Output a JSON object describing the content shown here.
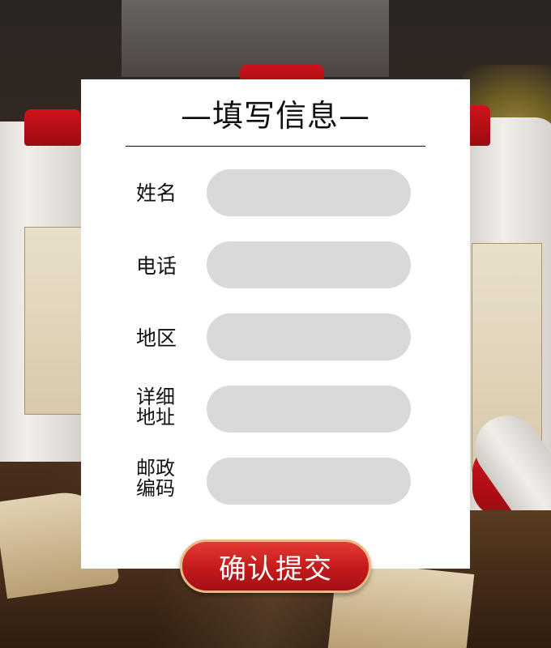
{
  "form": {
    "title": "—填写信息—",
    "fields": [
      {
        "label": "姓名",
        "value": ""
      },
      {
        "label": "电话",
        "value": ""
      },
      {
        "label": "地区",
        "value": ""
      },
      {
        "label_line1": "详细",
        "label_line2": "地址",
        "value": ""
      },
      {
        "label_line1": "邮政",
        "label_line2": "编码",
        "value": ""
      }
    ],
    "submit_label": "确认提交"
  },
  "colors": {
    "card_bg": "#ffffff",
    "field_bg": "#d9d8db",
    "button_red": "#c41a1c",
    "button_border": "#e9b982"
  }
}
